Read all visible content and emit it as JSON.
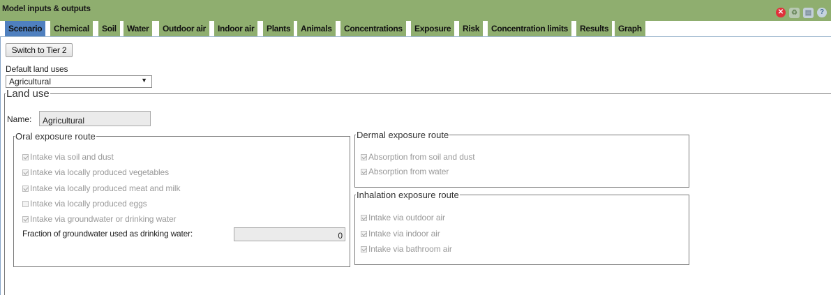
{
  "window": {
    "title": "Model inputs & outputs"
  },
  "titlebar_icons": [
    "close-circle-icon",
    "recycle-icon",
    "save-icon",
    "help-icon"
  ],
  "tabs": [
    {
      "label": "Scenario",
      "active": true
    },
    {
      "label": "Chemical"
    },
    {
      "label": "Soil"
    },
    {
      "label": "Water"
    },
    {
      "label": "Outdoor air"
    },
    {
      "label": "Indoor air"
    },
    {
      "label": "Plants"
    },
    {
      "label": "Animals"
    },
    {
      "label": "Concentrations"
    },
    {
      "label": "Exposure"
    },
    {
      "label": "Risk"
    },
    {
      "label": "Concentration limits"
    },
    {
      "label": "Results"
    },
    {
      "label": "Graph"
    }
  ],
  "scenario": {
    "tier_button": "Switch to Tier 2",
    "default_land_uses_label": "Default land uses",
    "default_land_use_selected": "Agricultural",
    "land_use": {
      "legend": "Land use",
      "name_label": "Name:",
      "name_value": "Agricultural",
      "oral": {
        "legend": "Oral exposure route",
        "items": [
          {
            "label": "Intake via soil and dust",
            "checked": true
          },
          {
            "label": "Intake via locally produced vegetables",
            "checked": true
          },
          {
            "label": "Intake via locally produced meat and milk",
            "checked": true
          },
          {
            "label": "Intake via locally produced eggs",
            "checked": false
          },
          {
            "label": "Intake via groundwater or drinking water",
            "checked": true
          }
        ],
        "fraction_label": "Fraction of groundwater used as drinking water:",
        "fraction_value": "0"
      },
      "dermal": {
        "legend": "Dermal exposure route",
        "items": [
          {
            "label": "Absorption from soil and dust",
            "checked": true
          },
          {
            "label": "Absorption from water",
            "checked": true
          }
        ]
      },
      "inhalation": {
        "legend": "Inhalation exposure route",
        "items": [
          {
            "label": "Intake via outdoor air",
            "checked": true
          },
          {
            "label": "Intake via indoor air",
            "checked": true
          },
          {
            "label": "Intake via bathroom air",
            "checked": true
          }
        ]
      }
    }
  },
  "colors": {
    "titlebar": "#8fae6f",
    "tab_active": "#4f80bf",
    "tab": "#8fae6f"
  }
}
